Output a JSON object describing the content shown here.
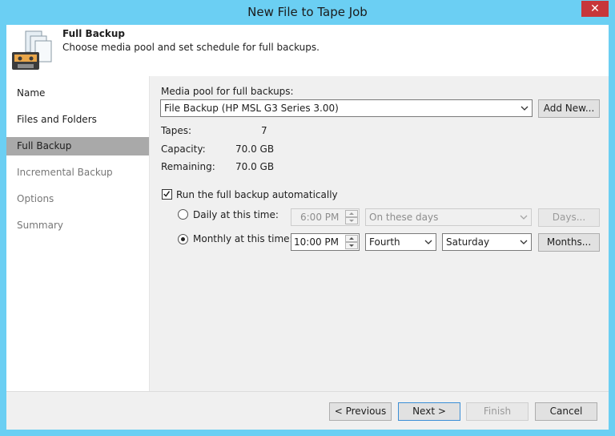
{
  "window": {
    "title": "New File to Tape Job",
    "close_glyph": "✕"
  },
  "header": {
    "title": "Full Backup",
    "subtitle": "Choose media pool and set schedule for full backups.",
    "icon": "tape-files-icon"
  },
  "nav": {
    "items": [
      {
        "label": "Name",
        "state": "done"
      },
      {
        "label": "Files and Folders",
        "state": "done"
      },
      {
        "label": "Full Backup",
        "state": "active"
      },
      {
        "label": "Incremental Backup",
        "state": "pending"
      },
      {
        "label": "Options",
        "state": "pending"
      },
      {
        "label": "Summary",
        "state": "pending"
      }
    ]
  },
  "media_pool": {
    "label": "Media pool for full backups:",
    "selected": "File Backup (HP MSL G3 Series 3.00)",
    "add_new_label": "Add New..."
  },
  "stats": {
    "tapes_label": "Tapes:",
    "tapes_value": "7",
    "capacity_label": "Capacity:",
    "capacity_value": "70.0 GB",
    "remaining_label": "Remaining:",
    "remaining_value": "70.0 GB"
  },
  "schedule": {
    "auto_label": "Run the full backup automatically",
    "auto_checked": true,
    "daily": {
      "label": "Daily at this time:",
      "time": "6:00 PM",
      "days_option": "On these days",
      "days_button": "Days...",
      "selected": false
    },
    "monthly": {
      "label": "Monthly at this time:",
      "time": "10:00 PM",
      "week": "Fourth",
      "day": "Saturday",
      "months_button": "Months...",
      "selected": true
    }
  },
  "footer": {
    "previous_label": "< Previous",
    "next_label": "Next >",
    "finish_label": "Finish",
    "cancel_label": "Cancel"
  },
  "colors": {
    "titlebar": "#6bcff3",
    "close": "#c7363a",
    "nav_active": "#a9a9a9",
    "primary_border": "#3b8fd6"
  }
}
